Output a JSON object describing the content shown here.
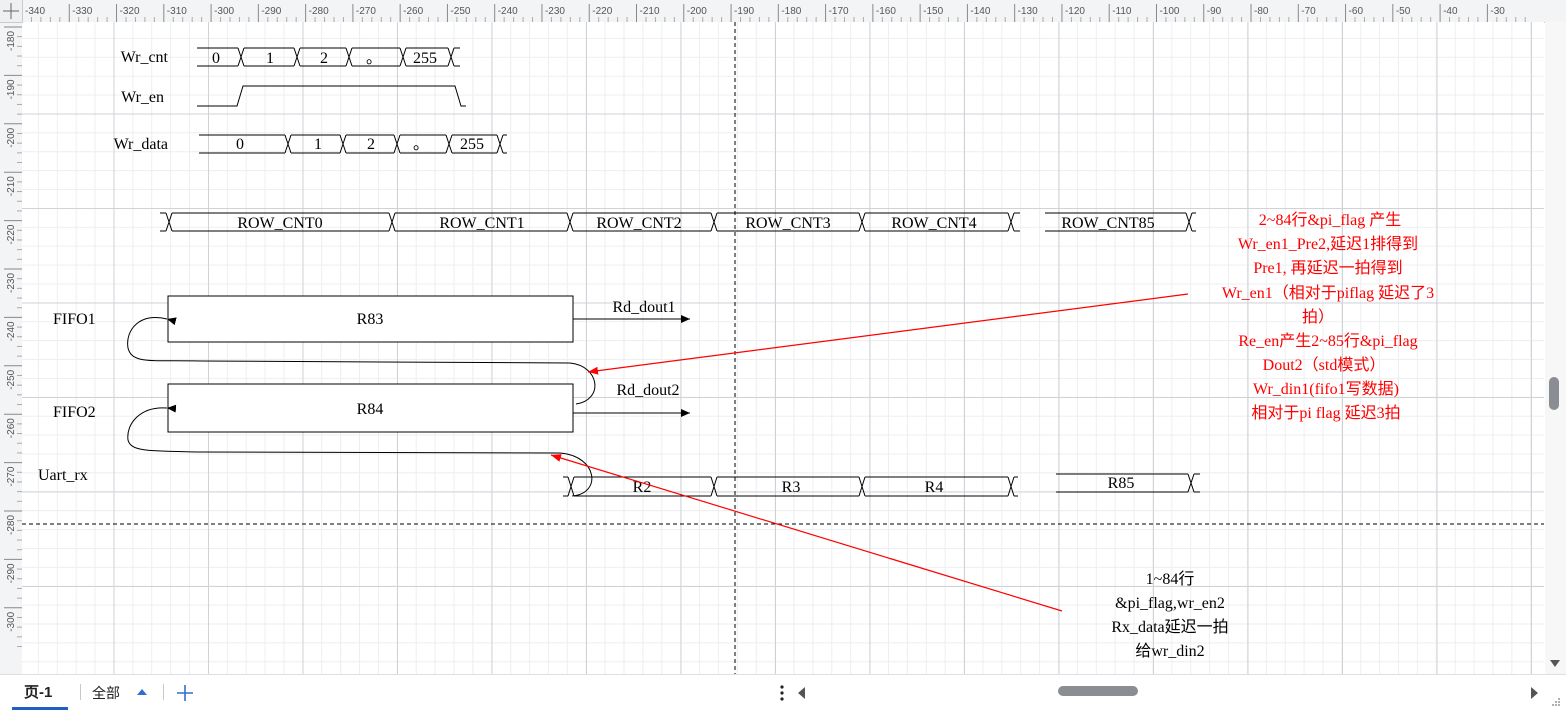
{
  "ruler": {
    "top_ticks": [
      "-340",
      "-330",
      "-320",
      "-310",
      "-300",
      "-290",
      "-280",
      "-270",
      "-260",
      "-250",
      "-240",
      "-230",
      "-220",
      "-210",
      "-200",
      "-190",
      "-180",
      "-170",
      "-160",
      "-150",
      "-140",
      "-130",
      "-120",
      "-110",
      "-100",
      "-90",
      "-80",
      "-70",
      "-60",
      "-50",
      "-40",
      "-30"
    ],
    "left_ticks": [
      "-180",
      "-190",
      "-200",
      "-210",
      "-220",
      "-230",
      "-240",
      "-250",
      "-260",
      "-270",
      "-280",
      "-290",
      "-300"
    ]
  },
  "diagram": {
    "signals": {
      "wr_cnt": "Wr_cnt",
      "wr_en": "Wr_en",
      "wr_data": "Wr_data",
      "fifo1": "FIFO1",
      "fifo2": "FIFO2",
      "uart_rx": "Uart_rx"
    },
    "wr_cnt_values": [
      "0",
      "1",
      "2",
      "。",
      "255"
    ],
    "wr_data_values": [
      "0",
      "1",
      "2",
      "。",
      "255"
    ],
    "row_cnt": [
      "ROW_CNT0",
      "ROW_CNT1",
      "ROW_CNT2",
      "ROW_CNT3",
      "ROW_CNT4",
      "ROW_CNT85"
    ],
    "uart_rows": [
      "R2",
      "R3",
      "R4",
      "R85"
    ],
    "fifo1_box": "R83",
    "fifo2_box": "R84",
    "rd_dout1": "Rd_dout1",
    "rd_dout2": "Rd_dout2",
    "note_red": [
      "2~84行&pi_flag 产生",
      "Wr_en1_Pre2,延迟1排得到",
      "Pre1, 再延迟一拍得到",
      "Wr_en1（相对于piflag 延迟了3",
      "拍）",
      "Re_en产生2~85行&pi_flag",
      "Dout2（std模式）",
      "Wr_din1(fifo1写数据)",
      "相对于pi flag 延迟3拍"
    ],
    "note_black": [
      "1~84行",
      "&pi_flag,wr_en2",
      "Rx_data延迟一拍",
      "给wr_din2"
    ],
    "colors": {
      "annotation": "#ff0000",
      "line": "#000000",
      "grid": "#cfd3d8"
    }
  },
  "statusbar": {
    "page_tab": "页-1",
    "all_pages": "全部",
    "add_icon": "plus-icon",
    "more_icon": "vertical-dots-icon"
  }
}
